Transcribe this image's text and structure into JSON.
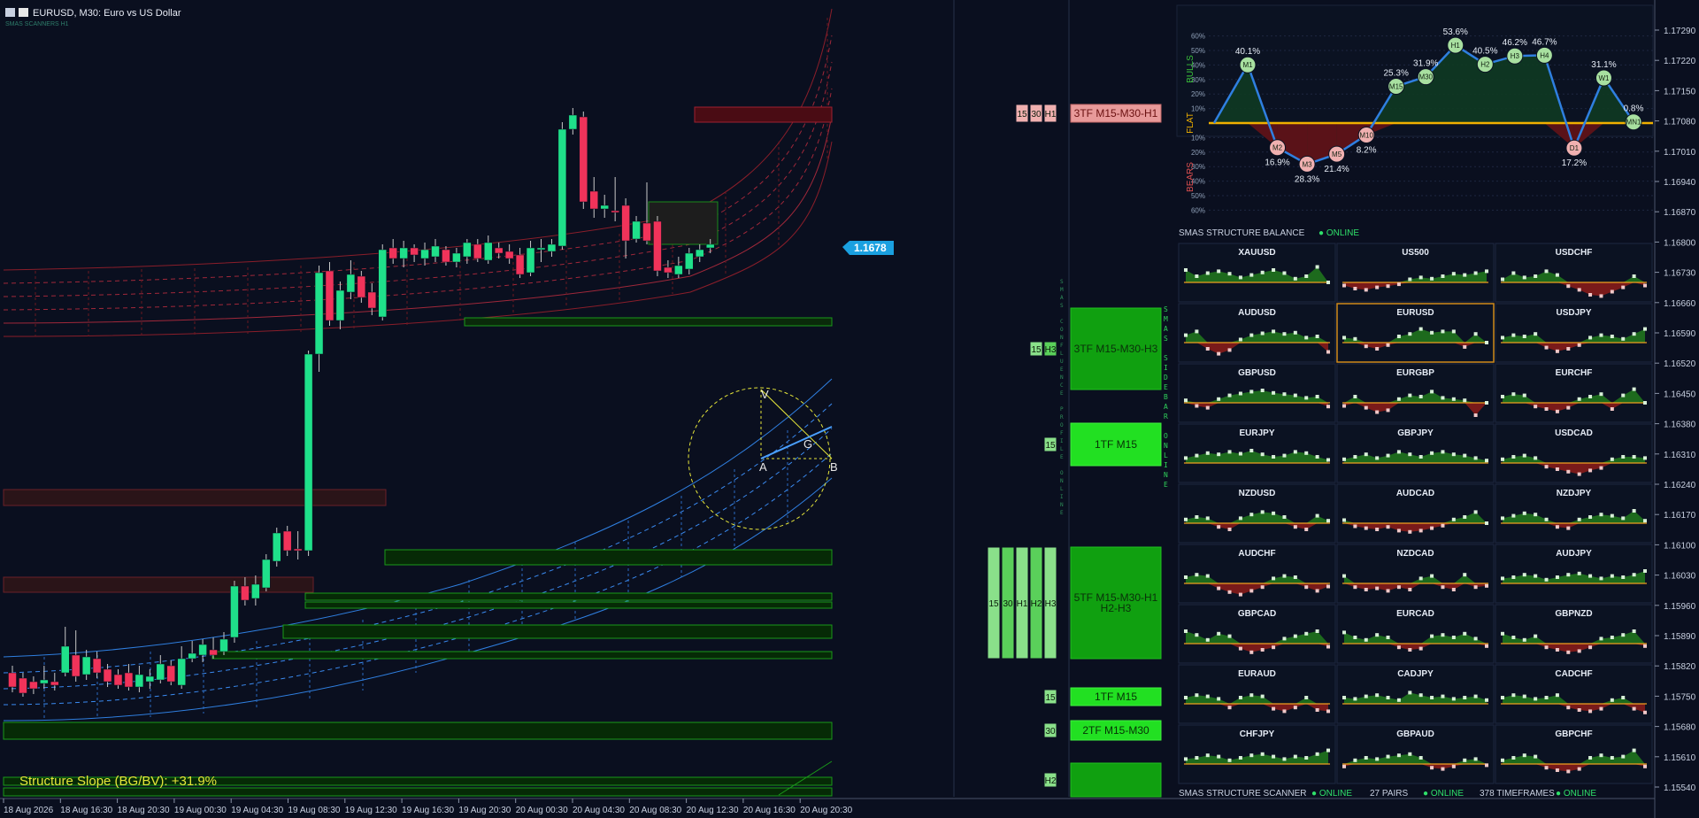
{
  "window": {
    "symbol_title": "EURUSD, M30:  Euro vs US Dollar",
    "subtitle": "SMAS SCANNERS H1"
  },
  "colors": {
    "background": "#0a0f1f",
    "bull_candle": "#1fe08a",
    "bear_candle": "#f0335a",
    "price_tag": "#1aa0e0",
    "green_zone": "#1a9a1a",
    "bright_green": "#22e022",
    "red_zone": "#c83a3a",
    "blue_channel": "#2f7fe0",
    "red_channel": "#8a1e2a",
    "flat_line": "#f0b000",
    "annotation_yellow": "#e6e63a"
  },
  "price_tag": "1.1678",
  "price_axis": [
    "1.17290",
    "1.17220",
    "1.17150",
    "1.17080",
    "1.17010",
    "1.16940",
    "1.16870",
    "1.16800",
    "1.16730",
    "1.16660",
    "1.16590",
    "1.16520",
    "1.16450",
    "1.16380",
    "1.16310",
    "1.16240",
    "1.16170",
    "1.16100",
    "1.16030",
    "1.15960",
    "1.15890",
    "1.15820",
    "1.15750",
    "1.15680",
    "1.15610",
    "1.15540"
  ],
  "time_axis": [
    "18 Aug 2026",
    "18 Aug 16:30",
    "18 Aug 20:30",
    "19 Aug 00:30",
    "19 Aug 04:30",
    "19 Aug 08:30",
    "19 Aug 12:30",
    "19 Aug 16:30",
    "19 Aug 20:30",
    "20 Aug 00:30",
    "20 Aug 04:30",
    "20 Aug 08:30",
    "20 Aug 12:30",
    "20 Aug 16:30",
    "20 Aug 20:30"
  ],
  "structure_slope": "Structure Slope (BG/BV): +31.9%",
  "fib_labels": {
    "v": "V",
    "g": "G",
    "a": "A",
    "b": "B"
  },
  "sidebar_vertical_1": "SMAS CONFLUENCE PROFILE ONLINE",
  "sidebar_vertical_2": "SMAS SIDEBAR ONLINE",
  "zones": [
    {
      "label": "3TF M15-M30-H1",
      "kind": "red",
      "tfs": [
        "15",
        "30",
        "H1"
      ]
    },
    {
      "label": "3TF M15-M30-H3",
      "kind": "green",
      "tfs": [
        "15",
        "H3"
      ]
    },
    {
      "label": "1TF M15",
      "kind": "bright",
      "tfs": [
        "15"
      ]
    },
    {
      "label": "5TF M15-M30-H1-H2-H3",
      "kind": "green",
      "tfs": [
        "15",
        "30",
        "H1",
        "H2",
        "H3"
      ]
    },
    {
      "label": "1TF M15",
      "kind": "bright",
      "tfs": [
        "15"
      ]
    },
    {
      "label": "2TF M15-M30",
      "kind": "bright",
      "tfs": [
        "30"
      ]
    },
    {
      "label": "",
      "kind": "green",
      "tfs": [
        "H2"
      ]
    }
  ],
  "balance": {
    "title": "SMAS STRUCTURE BALANCE",
    "status": "● ONLINE",
    "side_labels": {
      "bulls": "BULLS",
      "flat": "FLAT",
      "bears": "BEARS"
    },
    "y_ticks_up": [
      "60%",
      "50%",
      "40%",
      "30%",
      "20%",
      "10%"
    ],
    "y_ticks_down": [
      "10%",
      "20%",
      "30%",
      "40%",
      "50%",
      "60%"
    ],
    "points": [
      {
        "tf": "M1",
        "value": 40.1,
        "label": "40.1%"
      },
      {
        "tf": "M2",
        "value": -16.9,
        "label": "16.9%"
      },
      {
        "tf": "M3",
        "value": -28.3,
        "label": "28.3%"
      },
      {
        "tf": "M5",
        "value": -21.4,
        "label": "21.4%"
      },
      {
        "tf": "M10",
        "value": -8.2,
        "label": "8.2%"
      },
      {
        "tf": "M15",
        "value": 25.3,
        "label": "25.3%"
      },
      {
        "tf": "M30",
        "value": 31.9,
        "label": "31.9%"
      },
      {
        "tf": "H1",
        "value": 53.6,
        "label": "53.6%"
      },
      {
        "tf": "H2",
        "value": 40.5,
        "label": "40.5%"
      },
      {
        "tf": "H3",
        "value": 46.2,
        "label": "46.2%"
      },
      {
        "tf": "H4",
        "value": 46.7,
        "label": "46.7%"
      },
      {
        "tf": "D1",
        "value": -17.2,
        "label": "17.2%"
      },
      {
        "tf": "W1",
        "value": 31.1,
        "label": "31.1%"
      },
      {
        "tf": "MN1",
        "value": 0.8,
        "label": "0.8%"
      }
    ]
  },
  "scanner": {
    "footer": {
      "title": "SMAS STRUCTURE SCANNER",
      "status1": "● ONLINE",
      "pairs": "27 PAIRS",
      "status2": "● ONLINE",
      "tfs": "378 TIMEFRAMES",
      "status3": "● ONLINE"
    },
    "pairs": [
      {
        "name": "XAUUSD",
        "v": [
          20,
          10,
          15,
          18,
          14,
          8,
          12,
          16,
          20,
          15,
          6,
          10,
          25,
          0
        ]
      },
      {
        "name": "US500",
        "v": [
          -5,
          -10,
          -12,
          -8,
          -6,
          -3,
          5,
          8,
          6,
          10,
          14,
          12,
          15,
          18
        ]
      },
      {
        "name": "USDCHF",
        "v": [
          5,
          15,
          8,
          10,
          18,
          12,
          -6,
          -12,
          -20,
          -22,
          -15,
          -8,
          10,
          -5
        ]
      },
      {
        "name": "AUDUSD",
        "v": [
          12,
          18,
          -10,
          -18,
          -12,
          5,
          12,
          15,
          18,
          14,
          16,
          8,
          10,
          -15
        ]
      },
      {
        "name": "EURUSD",
        "v": [
          8,
          6,
          -6,
          -10,
          -4,
          10,
          14,
          22,
          16,
          18,
          18,
          -7,
          14,
          0
        ]
      },
      {
        "name": "USDJPY",
        "v": [
          8,
          12,
          10,
          14,
          -8,
          -14,
          -10,
          -4,
          8,
          12,
          10,
          6,
          14,
          22
        ]
      },
      {
        "name": "GBPUSD",
        "v": [
          4,
          -5,
          -8,
          6,
          12,
          15,
          18,
          20,
          16,
          14,
          12,
          8,
          10,
          -6
        ]
      },
      {
        "name": "EURGBP",
        "v": [
          -5,
          10,
          -8,
          -15,
          -12,
          6,
          12,
          10,
          18,
          8,
          6,
          4,
          -20,
          0
        ]
      },
      {
        "name": "EURCHF",
        "v": [
          10,
          14,
          12,
          -6,
          -10,
          -14,
          -8,
          6,
          10,
          14,
          -10,
          12,
          22,
          0
        ]
      },
      {
        "name": "EURJPY",
        "v": [
          8,
          12,
          16,
          14,
          18,
          15,
          20,
          14,
          10,
          12,
          18,
          16,
          10,
          5
        ]
      },
      {
        "name": "GBPJPY",
        "v": [
          6,
          10,
          14,
          8,
          12,
          18,
          14,
          10,
          16,
          18,
          14,
          12,
          8,
          4
        ]
      },
      {
        "name": "USDCAD",
        "v": [
          6,
          10,
          12,
          8,
          -6,
          -10,
          -14,
          -18,
          -12,
          -8,
          6,
          10,
          10,
          8
        ]
      },
      {
        "name": "NZDUSD",
        "v": [
          6,
          10,
          8,
          -6,
          -10,
          8,
          14,
          18,
          16,
          10,
          -6,
          -10,
          12,
          4
        ]
      },
      {
        "name": "AUDCAD",
        "v": [
          5,
          -5,
          -8,
          -10,
          -6,
          -12,
          -14,
          -12,
          -8,
          -4,
          6,
          10,
          18,
          0
        ]
      },
      {
        "name": "NZDJPY",
        "v": [
          8,
          12,
          16,
          14,
          6,
          -6,
          -8,
          6,
          10,
          14,
          12,
          8,
          20,
          4
        ]
      },
      {
        "name": "AUDCHF",
        "v": [
          10,
          14,
          12,
          -8,
          -14,
          -18,
          -12,
          -6,
          8,
          12,
          10,
          -6,
          -12,
          -5
        ]
      },
      {
        "name": "NZDCAD",
        "v": [
          12,
          -6,
          -10,
          -8,
          -12,
          -6,
          -10,
          8,
          12,
          -6,
          -10,
          14,
          -6,
          -4
        ]
      },
      {
        "name": "AUDJPY",
        "v": [
          8,
          10,
          14,
          12,
          6,
          10,
          14,
          16,
          12,
          8,
          12,
          10,
          14,
          20
        ]
      },
      {
        "name": "GBPCAD",
        "v": [
          20,
          14,
          6,
          16,
          12,
          -8,
          -14,
          -10,
          -6,
          8,
          12,
          16,
          20,
          -5
        ]
      },
      {
        "name": "EURCAD",
        "v": [
          18,
          10,
          6,
          14,
          10,
          -6,
          -10,
          -8,
          12,
          14,
          10,
          16,
          8,
          -4
        ]
      },
      {
        "name": "GBPNZD",
        "v": [
          16,
          10,
          6,
          12,
          -6,
          -10,
          -14,
          -12,
          -6,
          8,
          10,
          14,
          20,
          -4
        ]
      },
      {
        "name": "EURAUD",
        "v": [
          10,
          14,
          12,
          8,
          -6,
          10,
          14,
          12,
          -8,
          -12,
          -6,
          10,
          -10,
          -12
        ]
      },
      {
        "name": "CADJPY",
        "v": [
          10,
          8,
          12,
          14,
          10,
          6,
          18,
          14,
          10,
          12,
          8,
          10,
          12,
          6
        ]
      },
      {
        "name": "CADCHF",
        "v": [
          10,
          14,
          12,
          8,
          10,
          14,
          -6,
          -10,
          -12,
          -8,
          6,
          10,
          -8,
          -14
        ]
      },
      {
        "name": "CHFJPY",
        "v": [
          8,
          10,
          14,
          12,
          6,
          10,
          14,
          16,
          12,
          8,
          12,
          10,
          16,
          22
        ]
      },
      {
        "name": "GBPAUD",
        "v": [
          -4,
          6,
          10,
          8,
          12,
          14,
          16,
          10,
          -6,
          -8,
          -4,
          6,
          8,
          -2
        ]
      },
      {
        "name": "GBPCHF",
        "v": [
          6,
          10,
          14,
          12,
          -6,
          -10,
          -12,
          -8,
          10,
          14,
          10,
          12,
          22,
          -4
        ]
      }
    ]
  }
}
